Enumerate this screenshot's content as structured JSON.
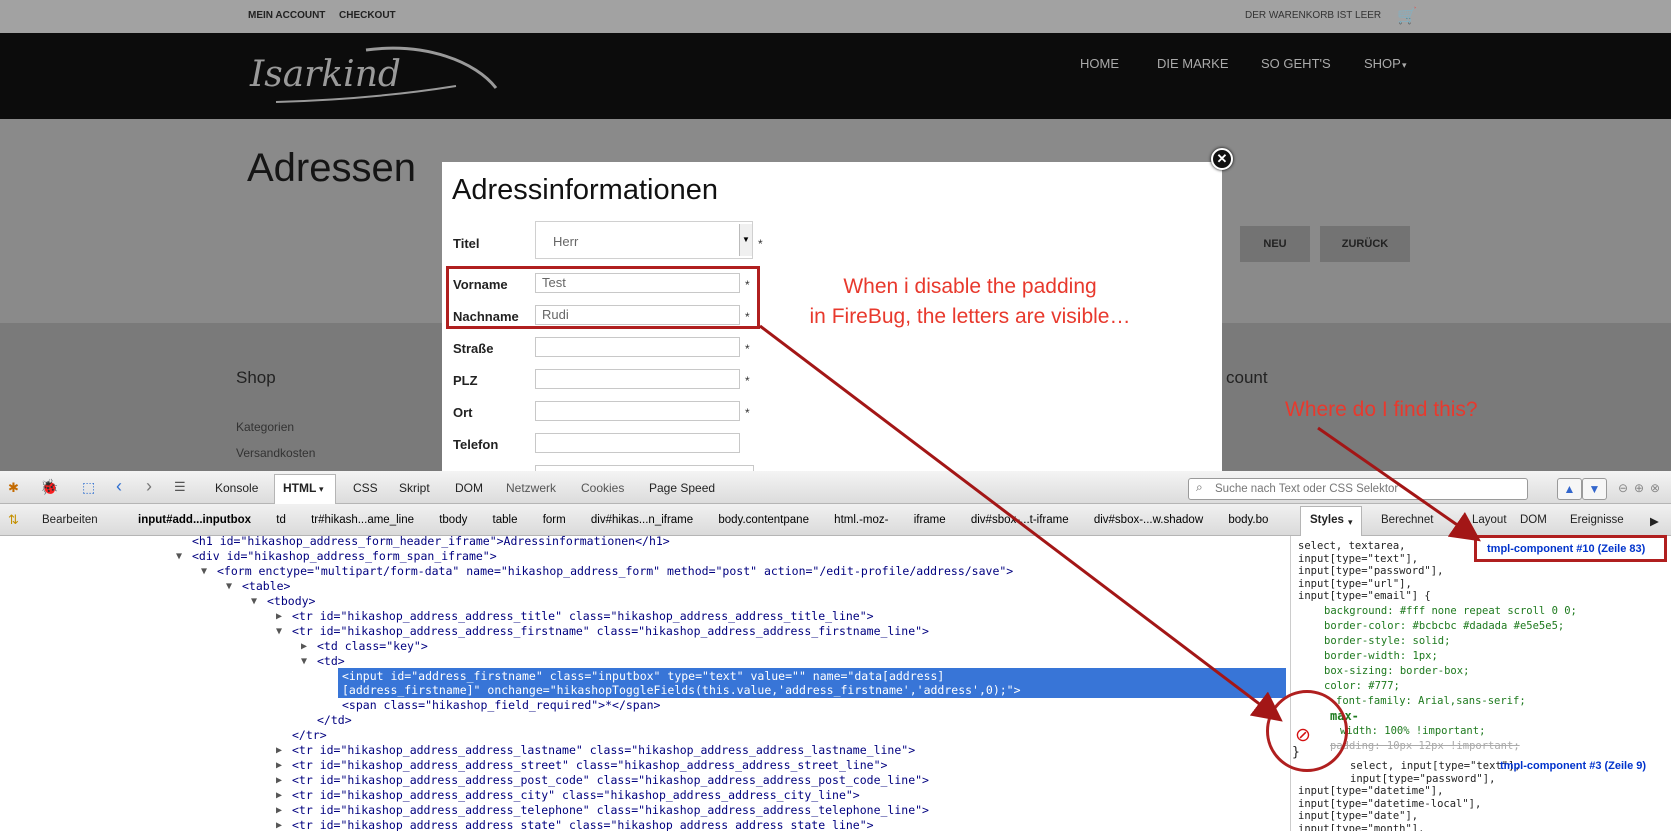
{
  "website": {
    "top_links": [
      "MEIN ACCOUNT",
      "CHECKOUT"
    ],
    "cart_text": "DER WARENKORB IST LEER",
    "cart_count": "0",
    "logo_text": "Isarkind",
    "nav": [
      "HOME",
      "DIE MARKE",
      "SO GEHT'S",
      "SHOP"
    ],
    "page_title": "Adressen",
    "buttons": [
      "NEU",
      "ZURÜCK"
    ],
    "footer_heading": "Shop",
    "footer_links": [
      "Kategorien",
      "Versandkosten"
    ],
    "footer_right_heading": "count"
  },
  "modal": {
    "title": "Adressinformationen",
    "fields": [
      {
        "label": "Titel",
        "value": "Herr"
      },
      {
        "label": "Vorname",
        "value": "Test"
      },
      {
        "label": "Nachname",
        "value": "Rudi"
      },
      {
        "label": "Straße",
        "value": ""
      },
      {
        "label": "PLZ",
        "value": ""
      },
      {
        "label": "Ort",
        "value": ""
      },
      {
        "label": "Telefon",
        "value": ""
      }
    ],
    "required_mark": "*"
  },
  "annotations": {
    "note1_line1": "When i disable the padding",
    "note1_line2": "in FireBug, the letters are visible…",
    "note2": "Where do I find this?"
  },
  "firebug": {
    "tabs": [
      "Konsole",
      "HTML",
      "CSS",
      "Skript",
      "DOM",
      "Netzwerk",
      "Cookies",
      "Page Speed"
    ],
    "search_placeholder": "Suche nach Text oder CSS Selektor",
    "edit_label": "Bearbeiten",
    "breadcrumbs": [
      "input#add...inputbox",
      "td",
      "tr#hikash...ame_line",
      "tbody",
      "table",
      "form",
      "div#hikas...n_iframe",
      "body.contentpane",
      "html.-moz-",
      "iframe",
      "div#sbox-...t-iframe",
      "div#sbox-...w.shadow",
      "body.bo"
    ],
    "side_tabs": [
      "Styles",
      "Berechnet",
      "Layout",
      "DOM",
      "Ereignisse"
    ],
    "html_lines": [
      "<h1 id=\"hikashop_address_form_header_iframe\">Adressinformationen</h1>",
      "<div id=\"hikashop_address_form_span_iframe\">",
      "<form enctype=\"multipart/form-data\" name=\"hikashop_address_form\" method=\"post\" action=\"/edit-profile/address/save\">",
      "<table>",
      "<tbody>",
      "<tr id=\"hikashop_address_address_title\" class=\"hikashop_address_address_title_line\">",
      "<tr id=\"hikashop_address_address_firstname\" class=\"hikashop_address_address_firstname_line\">",
      "<td class=\"key\">",
      "<td>",
      "<input id=\"address_firstname\" class=\"inputbox\" type=\"text\" value=\"\" name=\"data[address]",
      "[address_firstname]\" onchange=\"hikashopToggleFields(this.value,'address_firstname','address',0);\">",
      "<span class=\"hikashop_field_required\">*</span>",
      "</td>",
      "</tr>",
      "<tr id=\"hikashop_address_address_lastname\" class=\"hikashop_address_address_lastname_line\">",
      "<tr id=\"hikashop_address_address_street\" class=\"hikashop_address_address_street_line\">",
      "<tr id=\"hikashop_address_address_post_code\" class=\"hikashop_address_address_post_code_line\">",
      "<tr id=\"hikashop_address_address_city\" class=\"hikashop_address_address_city_line\">",
      "<tr id=\"hikashop_address_address_telephone\" class=\"hikashop_address_address_telephone_line\">",
      "<tr id=\"hikashop_address_address_state\" class=\"hikashop_address_address_state_line\">"
    ],
    "css_rule1": {
      "selectors": [
        "select, textarea,",
        "input[type=\"text\"],",
        "input[type=\"password\"],",
        "input[type=\"url\"],",
        "input[type=\"email\"] {"
      ],
      "source": "tmpl-component #10 (Zeile 83)",
      "props": [
        "background: #fff none repeat scroll 0 0;",
        "border-color: #bcbcbc #dadada #e5e5e5;",
        "border-style: solid;",
        "border-width: 1px;",
        "box-sizing: border-box;",
        "color: #777;",
        "font-family: Arial,sans-serif;",
        "max-",
        "width: 100% !important;",
        "padding: 10px 12px !important;"
      ],
      "close": "}"
    },
    "css_rule2": {
      "selectors": [
        "select, input[type=\"text\"],",
        "input[type=\"password\"],",
        "input[type=\"datetime\"],",
        "input[type=\"datetime-local\"],",
        "input[type=\"date\"],",
        "input[type=\"month\"],"
      ],
      "source": "tmpl-component #3 (Zeile 9)"
    }
  }
}
